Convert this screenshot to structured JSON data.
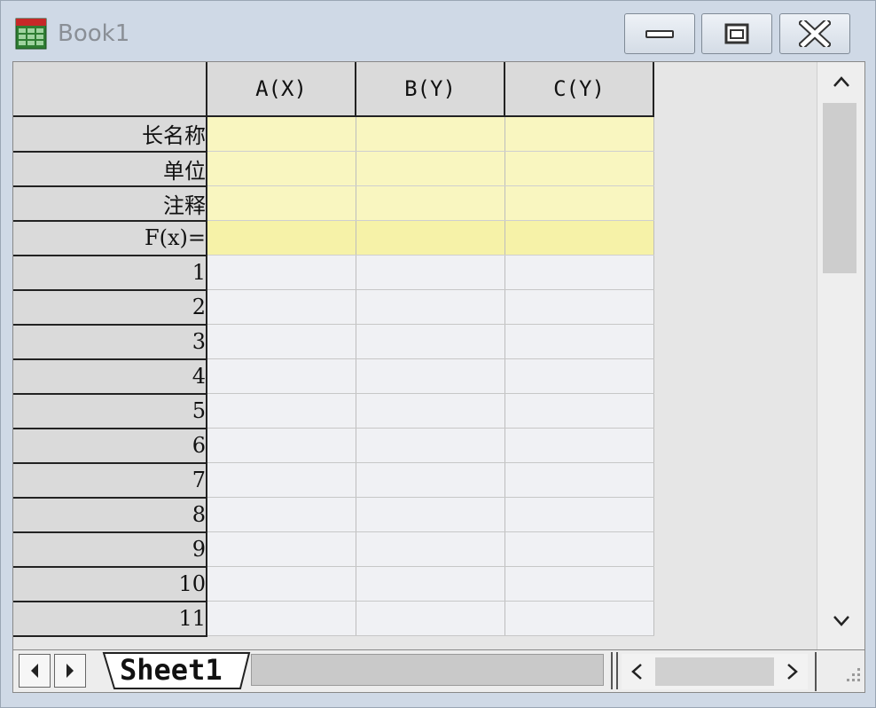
{
  "window": {
    "title": "Book1"
  },
  "columns": [
    "A(X)",
    "B(Y)",
    "C(Y)"
  ],
  "meta_rows": [
    "长名称",
    "单位",
    "注释",
    "F(x)="
  ],
  "data_rows": [
    "1",
    "2",
    "3",
    "4",
    "5",
    "6",
    "7",
    "8",
    "9",
    "10",
    "11"
  ],
  "sheet_tab": {
    "label": "Sheet1"
  },
  "icons": [
    "workbook-icon",
    "minimize-icon",
    "maximize-icon",
    "close-icon",
    "chevron-up-icon",
    "chevron-down-icon",
    "chevron-left-icon",
    "chevron-right-icon",
    "resize-grip-icon"
  ],
  "colors": {
    "meta_fill": "#f9f6c0",
    "cell_fill": "#f0f1f4",
    "header_fill": "#dadada"
  }
}
